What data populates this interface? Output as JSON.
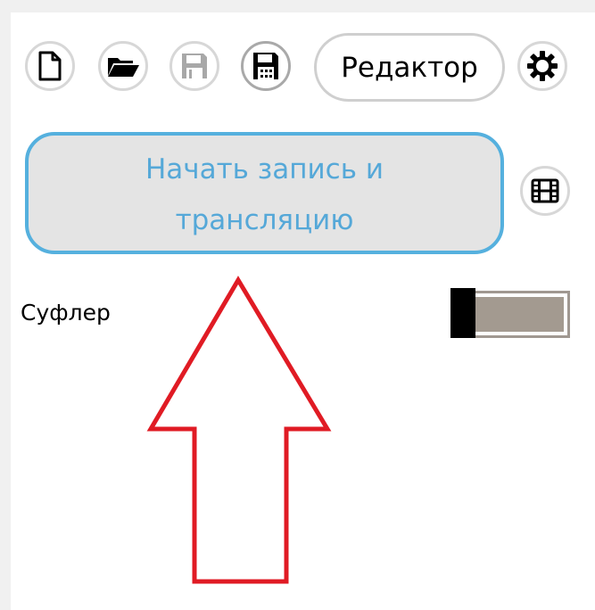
{
  "toolbar": {
    "editor_label": "Редактор",
    "new_icon": "new-document-icon",
    "open_icon": "open-folder-icon",
    "save_icon": "save-disk-icon",
    "save_as_icon": "save-as-disk-icon",
    "settings_icon": "gear-icon"
  },
  "record": {
    "label": "Начать запись и трансляцию",
    "film_icon": "film-strip-icon"
  },
  "prompter": {
    "label": "Суфлер",
    "toggle_state": "off"
  },
  "annotation": {
    "arrow_color": "#e01b24"
  },
  "colors": {
    "accent_blue": "#55b0de",
    "record_text": "#55a8d8",
    "toggle_fill": "#a39a90"
  }
}
